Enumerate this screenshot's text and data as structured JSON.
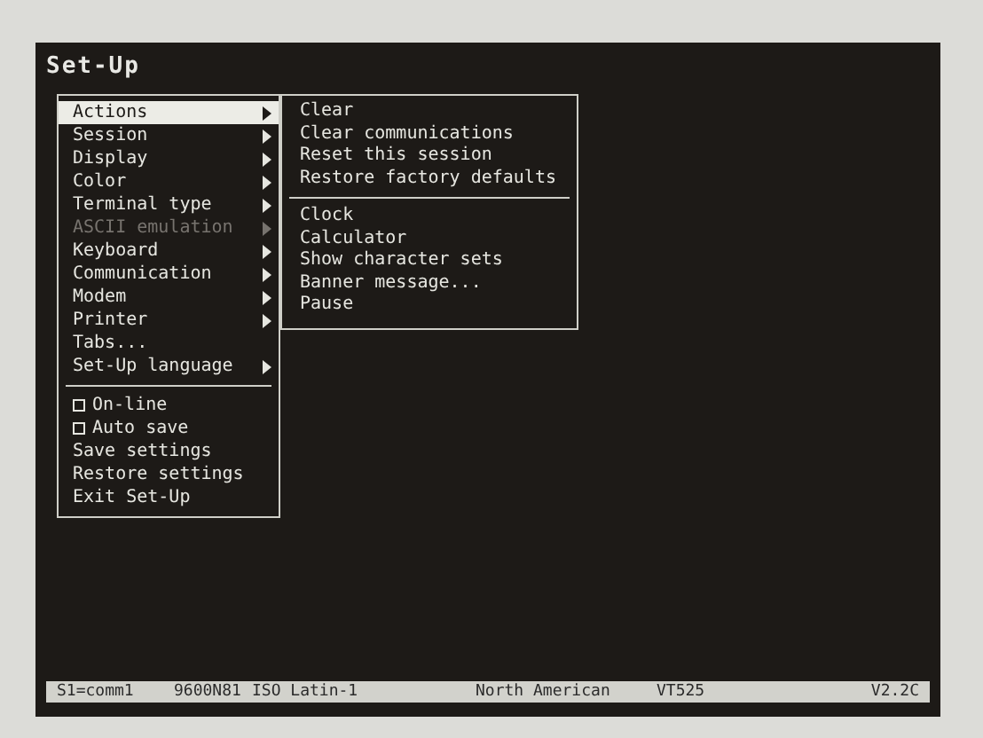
{
  "title": "Set-Up",
  "main_menu": {
    "sections": [
      [
        {
          "label": "Actions",
          "kind": "submenu",
          "selected": true,
          "disabled": false
        },
        {
          "label": "Session",
          "kind": "submenu",
          "selected": false,
          "disabled": false
        },
        {
          "label": "Display",
          "kind": "submenu",
          "selected": false,
          "disabled": false
        },
        {
          "label": "Color",
          "kind": "submenu",
          "selected": false,
          "disabled": false
        },
        {
          "label": "Terminal type",
          "kind": "submenu",
          "selected": false,
          "disabled": false
        },
        {
          "label": "ASCII emulation",
          "kind": "submenu",
          "selected": false,
          "disabled": true
        },
        {
          "label": "Keyboard",
          "kind": "submenu",
          "selected": false,
          "disabled": false
        },
        {
          "label": "Communication",
          "kind": "submenu",
          "selected": false,
          "disabled": false
        },
        {
          "label": "Modem",
          "kind": "submenu",
          "selected": false,
          "disabled": false
        },
        {
          "label": "Printer",
          "kind": "submenu",
          "selected": false,
          "disabled": false
        },
        {
          "label": "Tabs...",
          "kind": "action",
          "selected": false,
          "disabled": false
        },
        {
          "label": "Set-Up language",
          "kind": "submenu",
          "selected": false,
          "disabled": false
        }
      ],
      [
        {
          "label": "On-line",
          "kind": "checkbox",
          "checked": false,
          "selected": false,
          "disabled": false
        },
        {
          "label": "Auto save",
          "kind": "checkbox",
          "checked": false,
          "selected": false,
          "disabled": false
        },
        {
          "label": "Save settings",
          "kind": "action",
          "selected": false,
          "disabled": false
        },
        {
          "label": "Restore settings",
          "kind": "action",
          "selected": false,
          "disabled": false
        },
        {
          "label": "Exit Set-Up",
          "kind": "action",
          "selected": false,
          "disabled": false
        }
      ]
    ]
  },
  "submenu": {
    "sections": [
      [
        "Clear",
        "Clear communications",
        "Reset this session",
        "Restore factory defaults"
      ],
      [
        "Clock",
        "Calculator",
        "Show character sets",
        "Banner message...",
        "Pause"
      ]
    ]
  },
  "status_bar": [
    "S1=comm1",
    "9600N81",
    "ISO Latin-1",
    "North American",
    "VT525",
    "V2.2C"
  ]
}
